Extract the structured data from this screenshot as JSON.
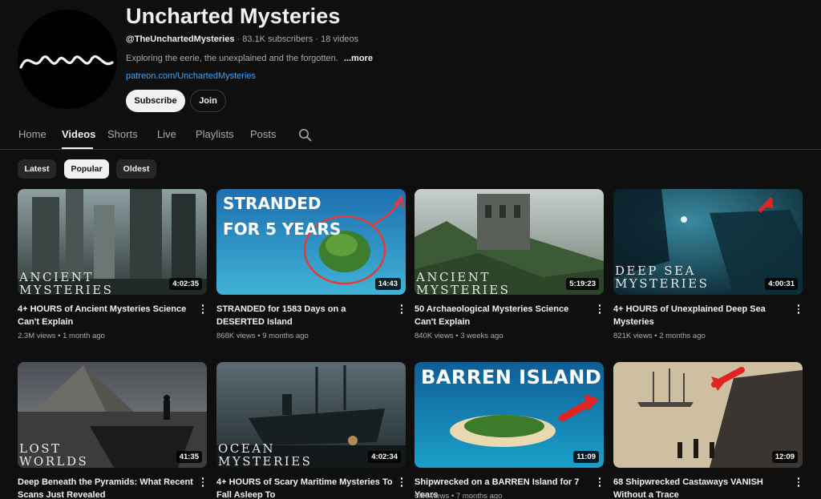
{
  "channel": {
    "name": "Uncharted Mysteries",
    "handle": "@TheUnchartedMysteries",
    "subscribers": "83.1K subscribers",
    "video_count": "18 videos",
    "separator": "·",
    "description": "Exploring the eerie, the unexplained and the forgotten.",
    "more_label": "...more",
    "link": "patreon.com/UnchartedMysteries",
    "subscribe_label": "Subscribe",
    "join_label": "Join"
  },
  "tabs": [
    {
      "label": "Home"
    },
    {
      "label": "Videos",
      "active": true
    },
    {
      "label": "Shorts"
    },
    {
      "label": "Live"
    },
    {
      "label": "Playlists"
    },
    {
      "label": "Posts"
    }
  ],
  "filters": [
    {
      "label": "Latest"
    },
    {
      "label": "Popular",
      "active": true
    },
    {
      "label": "Oldest"
    }
  ],
  "videos": [
    {
      "title": "4+ HOURS of Ancient Mysteries Science Can't Explain",
      "views": "2.3M views",
      "age": "1 month ago",
      "duration": "4:02:35",
      "overlay": [
        "ANCIENT",
        "MYSTERIES"
      ]
    },
    {
      "title": "STRANDED for 1583 Days on a DESERTED Island",
      "views": "868K views",
      "age": "9 months ago",
      "duration": "14:43",
      "overlay": [
        "STRANDED",
        "FOR 5 YEARS"
      ]
    },
    {
      "title": "50 Archaeological Mysteries Science Can't Explain",
      "views": "840K views",
      "age": "3 weeks ago",
      "duration": "5:19:23",
      "overlay": [
        "ANCIENT",
        "MYSTERIES"
      ]
    },
    {
      "title": "4+ HOURS of Unexplained Deep Sea Mysteries",
      "views": "821K views",
      "age": "2 months ago",
      "duration": "4:00:31",
      "overlay": [
        "DEEP SEA",
        "MYSTERIES"
      ]
    },
    {
      "title": "Deep Beneath the Pyramids: What Recent Scans Just Revealed",
      "views": "",
      "age": "",
      "duration": "41:35",
      "overlay": [
        "LOST",
        "WORLDS"
      ]
    },
    {
      "title": "4+ HOURS of Scary Maritime Mysteries To Fall Asleep To",
      "views": "",
      "age": "",
      "duration": "4:02:34",
      "overlay": [
        "OCEAN",
        "MYSTERIES"
      ]
    },
    {
      "title": "Shipwrecked on a BARREN Island for 7 Years",
      "views": "60K views",
      "age": "7 months ago",
      "duration": "11:09",
      "overlay": [
        "BARREN ISLAND"
      ]
    },
    {
      "title": "68 Shipwrecked Castaways VANISH Without a Trace",
      "views": "",
      "age": "",
      "duration": "12:09",
      "overlay": []
    }
  ],
  "icons": {
    "search": "search-icon",
    "kebab": "more-vert-icon",
    "logo": "wave-logo-icon"
  },
  "colors": {
    "background": "#0f0f0f",
    "link": "#3ea6ff",
    "accent_red": "#e02424"
  }
}
